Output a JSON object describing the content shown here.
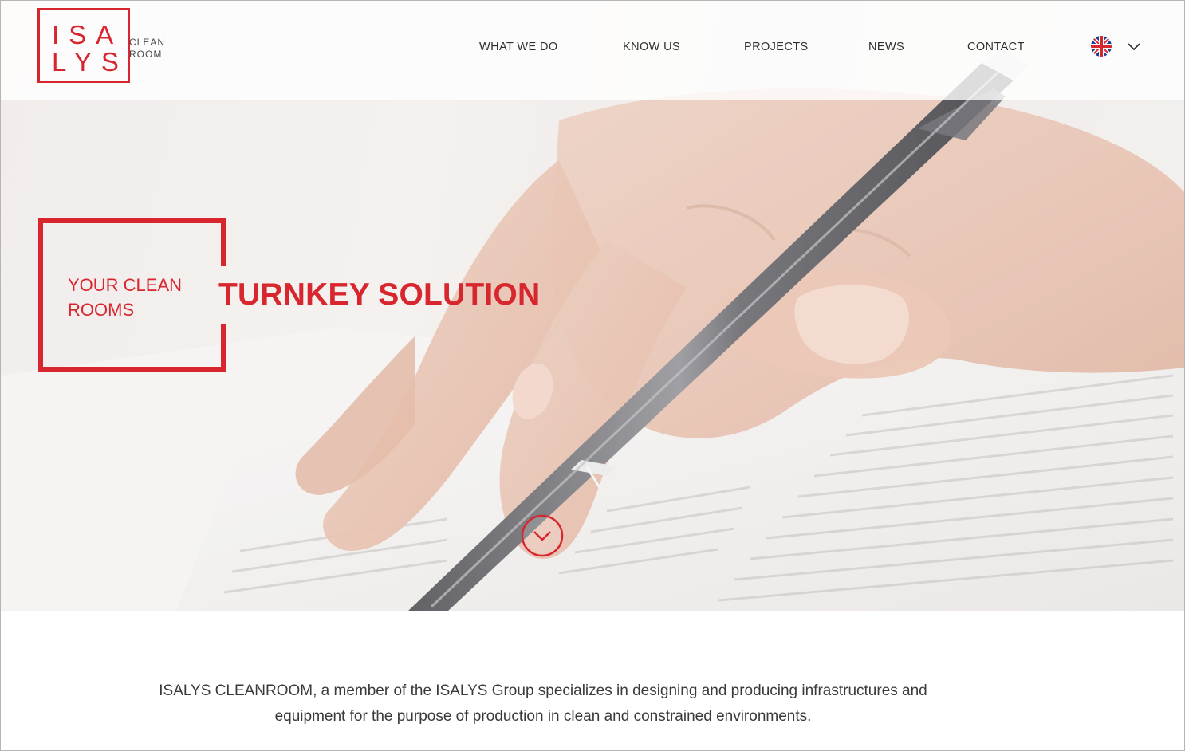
{
  "header": {
    "logo": {
      "line1": "ISA",
      "line2": "LYS",
      "sub1": "CLEAN",
      "sub2": "ROOM"
    },
    "nav": [
      {
        "label": "WHAT WE DO"
      },
      {
        "label": "KNOW US"
      },
      {
        "label": "PROJECTS"
      },
      {
        "label": "NEWS"
      },
      {
        "label": "CONTACT"
      }
    ],
    "language": {
      "flag_icon": "uk-flag-icon",
      "chevron_icon": "chevron-down-icon"
    }
  },
  "hero": {
    "tagline_line1": "YOUR CLEAN",
    "tagline_line2": "ROOMS",
    "headline": "TURNKEY SOLUTION",
    "scroll_icon": "scroll-down-icon",
    "background_image": "hand-with-pen-on-document-photo"
  },
  "intro": {
    "line1": "ISALYS CLEANROOM, a member of the ISALYS Group specializes in designing and producing infrastructures and",
    "line2": "equipment for the purpose of production in clean and constrained environments."
  },
  "colors": {
    "brand_red": "#d8262e",
    "text_dark": "#2f2f2f",
    "body_text": "#3a3a3a"
  }
}
